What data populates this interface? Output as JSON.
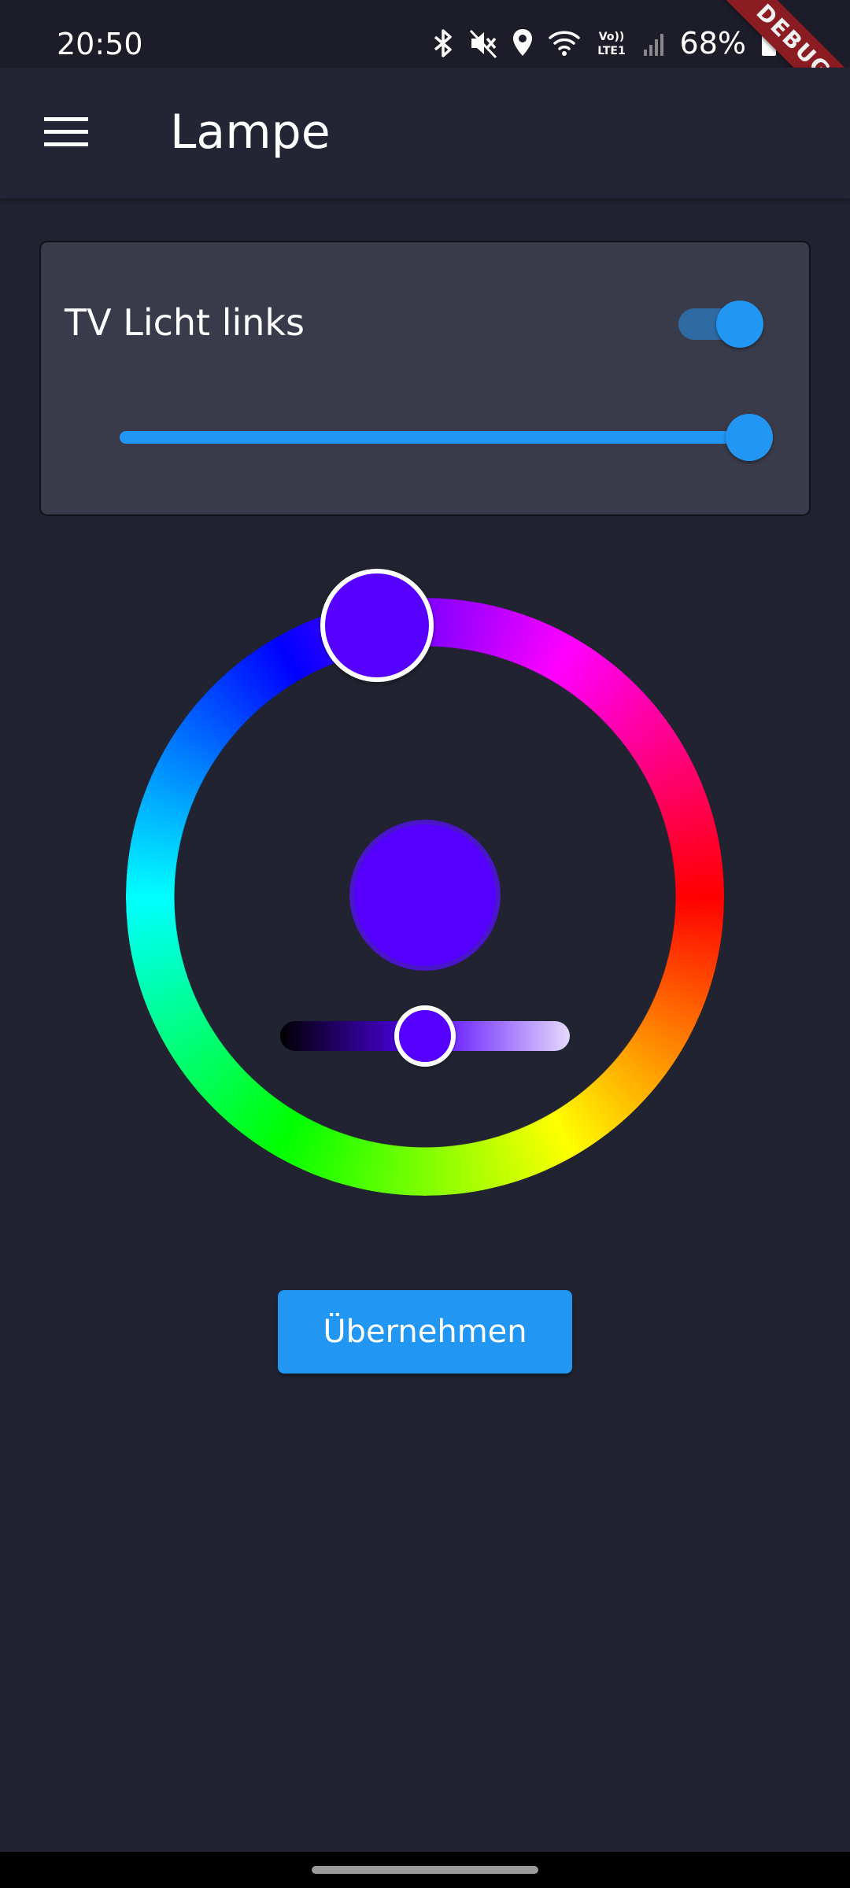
{
  "status_bar": {
    "time": "20:50",
    "battery": "68%",
    "network_label": "Vo)) LTE1",
    "icons": [
      "bluetooth-icon",
      "mute-icon",
      "location-icon",
      "wifi-icon",
      "lte-icon",
      "signal-icon",
      "battery-icon"
    ]
  },
  "debug_banner": "DEBUG",
  "app_bar": {
    "title": "Lampe",
    "menu_icon": "hamburger-menu-icon"
  },
  "device_card": {
    "name": "TV Licht links",
    "power_on": true,
    "brightness": 1.0,
    "accent_color": "#2196f3"
  },
  "color_picker": {
    "selected_color": "#5500ff",
    "hue_degrees": 260,
    "value_level": 0.5
  },
  "apply_button": {
    "label": "Übernehmen"
  },
  "colors": {
    "background": "#212331",
    "card": "#3a3b4a",
    "accent": "#2196f3"
  }
}
